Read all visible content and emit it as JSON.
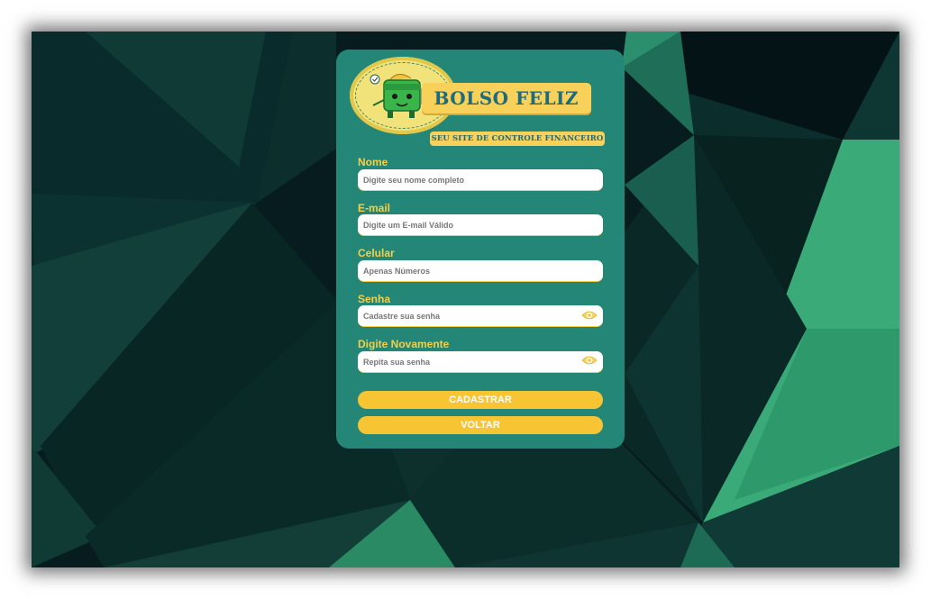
{
  "brand": {
    "title": "BOLSO FELIZ",
    "subtitle": "SEU SITE DE CONTROLE FINANCEIRO"
  },
  "form": {
    "name": {
      "label": "Nome",
      "placeholder": "Digite seu nome completo"
    },
    "email": {
      "label": "E-mail",
      "placeholder": "Digite um E-mail Válido"
    },
    "phone": {
      "label": "Celular",
      "placeholder": "Apenas Números"
    },
    "password": {
      "label": "Senha",
      "placeholder": "Cadastre sua senha",
      "icon": "eye-icon"
    },
    "confirm": {
      "label": "Digite Novamente",
      "placeholder": "Repita sua senha",
      "icon": "eye-icon"
    }
  },
  "buttons": {
    "submit": "CADASTRAR",
    "back": "VOLTAR"
  },
  "colors": {
    "card": "#248676",
    "accent": "#f7c534",
    "label": "#f4cf4a",
    "brand_text": "#1f6b7a"
  }
}
